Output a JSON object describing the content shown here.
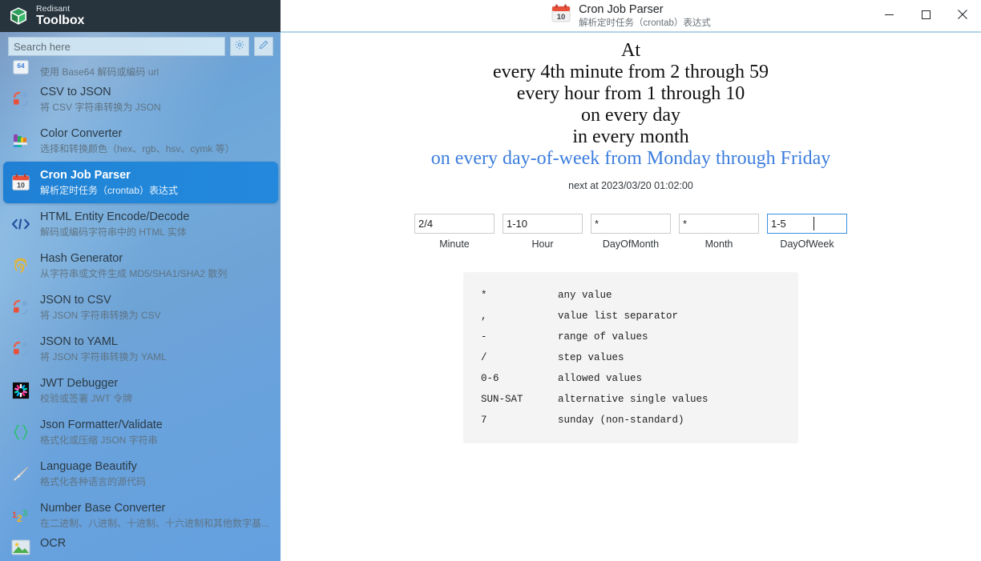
{
  "app": {
    "brand_top": "Redisant",
    "brand_bottom": "Toolbox"
  },
  "search": {
    "placeholder": "Search here",
    "value": "",
    "settings_icon": "gear-icon",
    "edit_icon": "pencil-icon"
  },
  "sidebar": {
    "items": [
      {
        "title": "",
        "desc": "使用 Base64 解码或编码 url",
        "icon": "base64-icon",
        "selected": false,
        "clipped_top": true
      },
      {
        "title": "CSV to JSON",
        "desc": "将 CSV 字符串转换为 JSON",
        "icon": "csv-to-json-icon",
        "selected": false
      },
      {
        "title": "Color Converter",
        "desc": "选择和转换颜色（hex、rgb、hsv、cymk 等）",
        "icon": "color-palette-icon",
        "selected": false
      },
      {
        "title": "Cron Job Parser",
        "desc": "解析定时任务（crontab）表达式",
        "icon": "calendar-icon",
        "selected": true
      },
      {
        "title": "HTML Entity Encode/Decode",
        "desc": "解码或编码字符串中的 HTML 实体",
        "icon": "code-brackets-icon",
        "selected": false
      },
      {
        "title": "Hash Generator",
        "desc": "从字符串或文件生成 MD5/SHA1/SHA2 散列",
        "icon": "fingerprint-icon",
        "selected": false
      },
      {
        "title": "JSON to CSV",
        "desc": "将 JSON 字符串转换为 CSV",
        "icon": "json-to-csv-icon",
        "selected": false
      },
      {
        "title": "JSON to YAML",
        "desc": "将 JSON 字符串转换为 YAML",
        "icon": "json-to-yaml-icon",
        "selected": false
      },
      {
        "title": "JWT Debugger",
        "desc": "校验或签署 JWT 令牌",
        "icon": "jwt-icon",
        "selected": false
      },
      {
        "title": "Json Formatter/Validate",
        "desc": "格式化或压缩 JSON 字符串",
        "icon": "braces-icon",
        "selected": false
      },
      {
        "title": "Language Beautify",
        "desc": "格式化各种语言的源代码",
        "icon": "brush-icon",
        "selected": false
      },
      {
        "title": "Number Base Converter",
        "desc": "在二进制、八进制、十进制、十六进制和其他数字基...",
        "icon": "numbers-icon",
        "selected": false
      },
      {
        "title": "OCR",
        "desc": "",
        "icon": "image-icon",
        "selected": false,
        "clipped_bottom": true
      }
    ]
  },
  "window": {
    "title": "Cron Job Parser",
    "subtitle": "解析定时任务（crontab）表达式",
    "icon": "calendar-icon",
    "minimize_label": "—",
    "maximize_label": "□",
    "close_label": "✕"
  },
  "main": {
    "description_lines": [
      {
        "text": "At",
        "highlight": false
      },
      {
        "text": "every 4th minute from 2 through 59",
        "highlight": false
      },
      {
        "text": "every hour from 1 through 10",
        "highlight": false
      },
      {
        "text": "on every day",
        "highlight": false
      },
      {
        "text": "in every month",
        "highlight": false
      },
      {
        "text": "on every day-of-week from Monday through Friday",
        "highlight": true
      }
    ],
    "next_run": "next at 2023/03/20 01:02:00",
    "highlight_color": "#3b7ddd",
    "fields": [
      {
        "label": "Minute",
        "value": "2/4",
        "focused": false
      },
      {
        "label": "Hour",
        "value": "1-10",
        "focused": false
      },
      {
        "label": "DayOfMonth",
        "value": "*",
        "focused": false
      },
      {
        "label": "Month",
        "value": "*",
        "focused": false
      },
      {
        "label": "DayOfWeek",
        "value": "1-5",
        "focused": true
      }
    ],
    "legend": [
      {
        "symbol": "*",
        "meaning": "any value"
      },
      {
        "symbol": ",",
        "meaning": "value list separator"
      },
      {
        "symbol": "-",
        "meaning": "range of values"
      },
      {
        "symbol": "/",
        "meaning": "step values"
      },
      {
        "symbol": "0-6",
        "meaning": "allowed values"
      },
      {
        "symbol": "SUN-SAT",
        "meaning": "alternative single values"
      },
      {
        "symbol": "7",
        "meaning": "sunday (non-standard)"
      }
    ]
  }
}
